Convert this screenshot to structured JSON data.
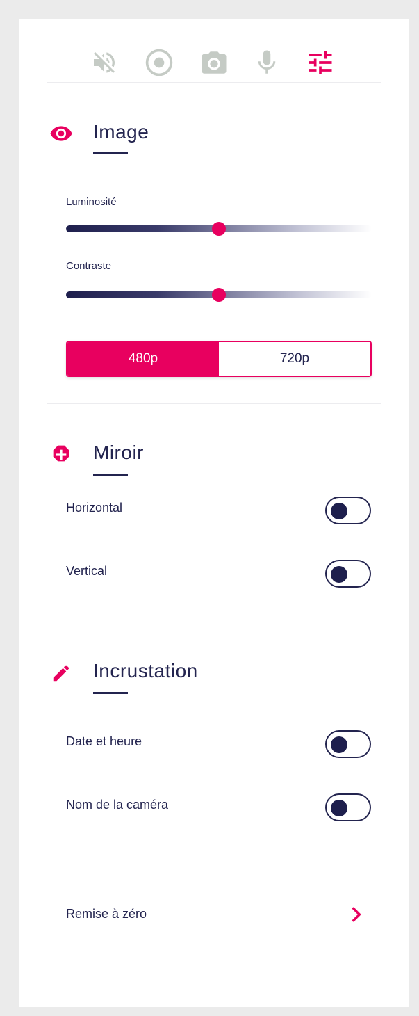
{
  "toolbar": {
    "icons": [
      "volume-off-icon",
      "record-icon",
      "camera-icon",
      "microphone-icon",
      "sliders-icon"
    ],
    "active": "sliders-icon",
    "inactive_color": "#c5cbc5",
    "active_color": "#e8005f"
  },
  "image": {
    "title": "Image",
    "brightness_label": "Luminosité",
    "brightness_value": 0.5,
    "contrast_label": "Contraste",
    "contrast_value": 0.5,
    "resolutions": [
      "480p",
      "720p"
    ],
    "selected_resolution": "480p"
  },
  "mirror": {
    "title": "Miroir",
    "horizontal_label": "Horizontal",
    "horizontal_on": false,
    "vertical_label": "Vertical",
    "vertical_on": false
  },
  "overlay": {
    "title": "Incrustation",
    "datetime_label": "Date et heure",
    "datetime_on": false,
    "camera_name_label": "Nom de la caméra",
    "camera_name_on": false
  },
  "reset": {
    "label": "Remise à zéro"
  },
  "colors": {
    "accent": "#e8005f",
    "navy": "#23244f",
    "background": "#ebebeb"
  }
}
